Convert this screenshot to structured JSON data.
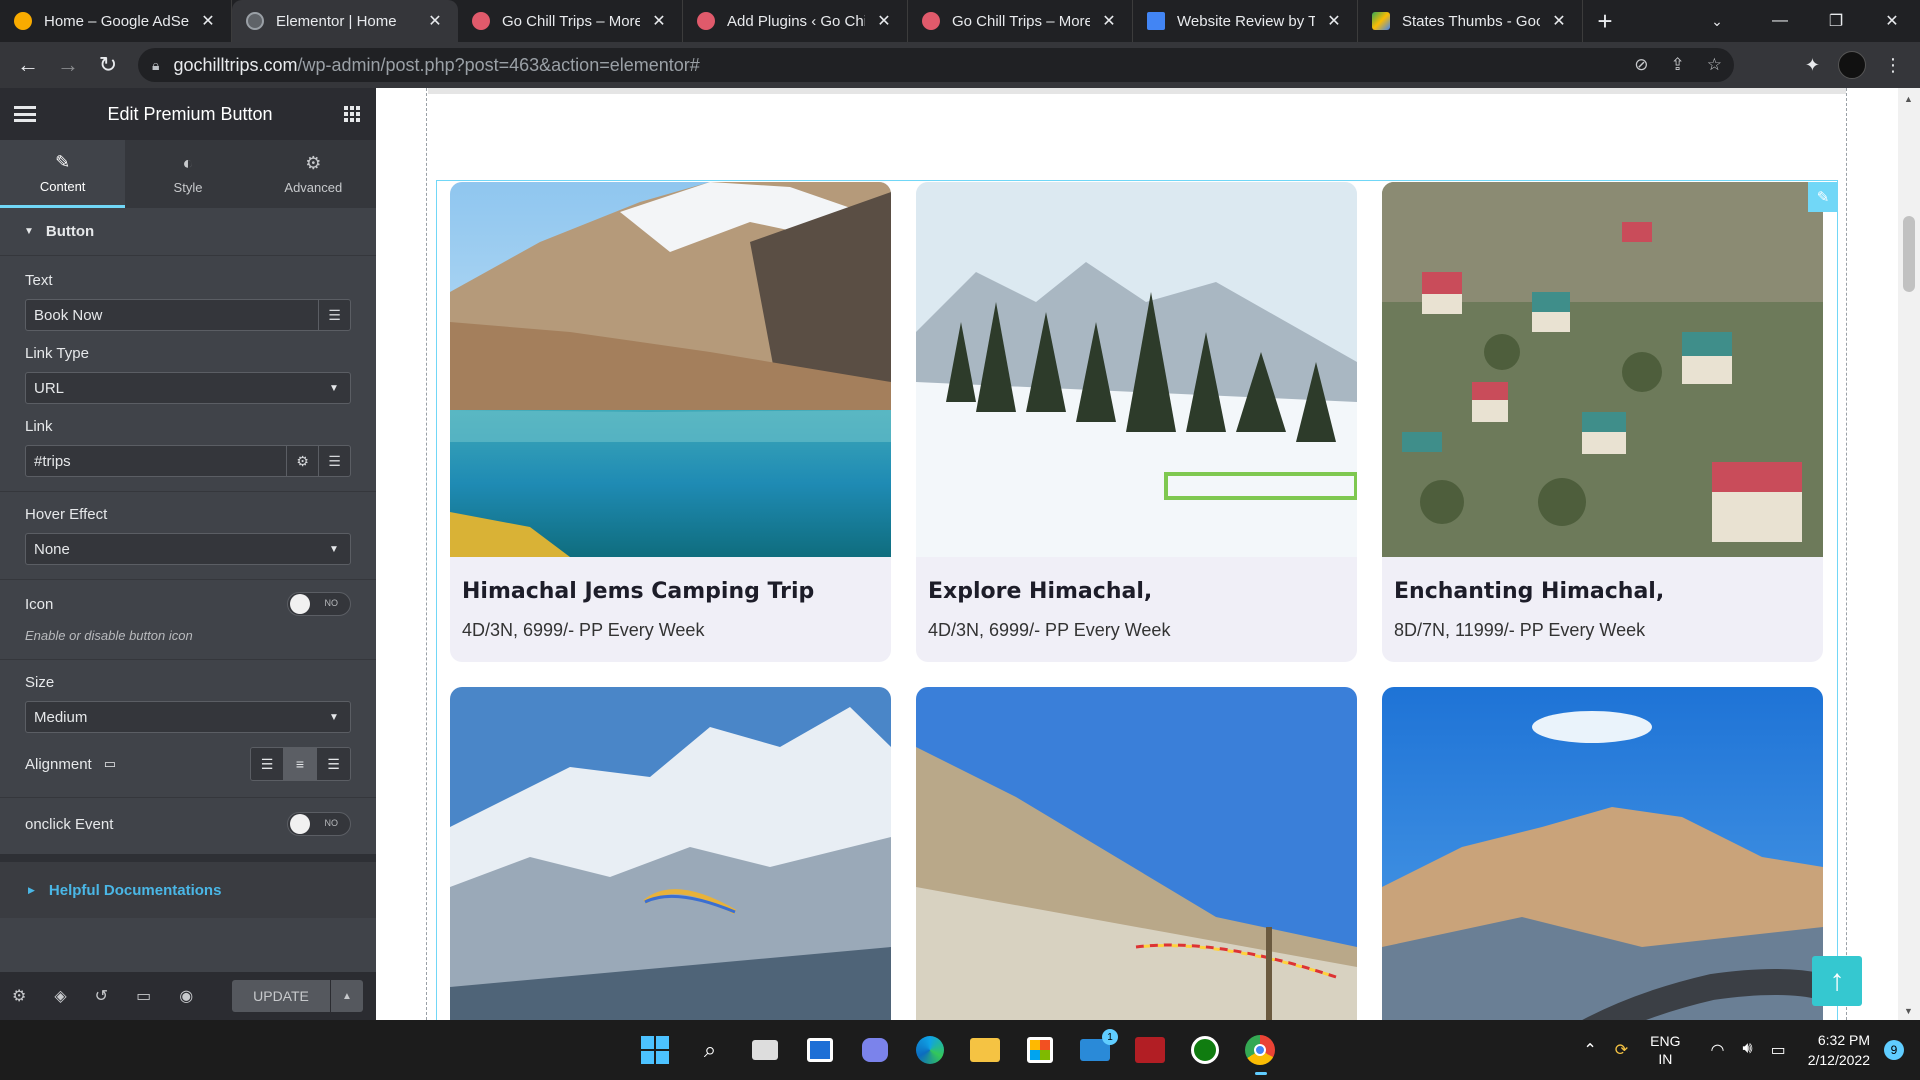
{
  "browser": {
    "tabs": [
      {
        "title": "Home – Google AdSe",
        "favicon_color": "#f9ab00",
        "active": false
      },
      {
        "title": "Elementor | Home",
        "favicon_color": "#9aa0a6",
        "active": true
      },
      {
        "title": "Go Chill Trips – More",
        "favicon_color": "#e05a6b",
        "active": false
      },
      {
        "title": "Add Plugins ‹ Go Chill",
        "favicon_color": "#e05a6b",
        "active": false
      },
      {
        "title": "Go Chill Trips – More",
        "favicon_color": "#e05a6b",
        "active": false
      },
      {
        "title": "Website Review by Te",
        "favicon_color": "#4285f4",
        "active": false
      },
      {
        "title": "States Thumbs - Goog",
        "favicon_color": "#34a853",
        "active": false
      }
    ],
    "new_tab_label": "+",
    "url_host": "gochilltrips.com",
    "url_rest": "/wp-admin/post.php?post=463&action=elementor#"
  },
  "panel": {
    "title": "Edit Premium Button",
    "tabs": [
      {
        "label": "Content",
        "icon": "pencil-icon",
        "glyph": "✎"
      },
      {
        "label": "Style",
        "icon": "half-circle-icon",
        "glyph": "◐"
      },
      {
        "label": "Advanced",
        "icon": "gear-icon",
        "glyph": "⚙"
      }
    ],
    "section_title": "Button",
    "text_label": "Text",
    "text_value": "Book Now",
    "link_type_label": "Link Type",
    "link_type_value": "URL",
    "link_label": "Link",
    "link_value": "#trips",
    "hover_label": "Hover Effect",
    "hover_value": "None",
    "icon_label": "Icon",
    "icon_toggle": "NO",
    "icon_desc": "Enable or disable button icon",
    "size_label": "Size",
    "size_value": "Medium",
    "alignment_label": "Alignment",
    "alignment_selected": "center",
    "onclick_label": "onclick Event",
    "onclick_toggle": "NO",
    "helpful_label": "Helpful Documentations",
    "update_label": "UPDATE"
  },
  "cards": [
    {
      "title": "Himachal Jems Camping Trip",
      "subtitle": "4D/3N, 6999/- PP Every Week",
      "scene": "lake"
    },
    {
      "title": "Explore Himachal,",
      "subtitle": " 4D/3N, 6999/- PP Every Week",
      "scene": "snow"
    },
    {
      "title": "Enchanting Himachal,",
      "subtitle": " 8D/7N, 11999/- PP Every Week",
      "scene": "town"
    },
    {
      "scene": "peaks"
    },
    {
      "scene": "valley"
    },
    {
      "scene": "road"
    }
  ],
  "taskbar": {
    "lang_top": "ENG",
    "lang_bottom": "IN",
    "time": "6:32 PM",
    "date": "2/12/2022",
    "notif_count": "9",
    "mail_badge": "1"
  }
}
